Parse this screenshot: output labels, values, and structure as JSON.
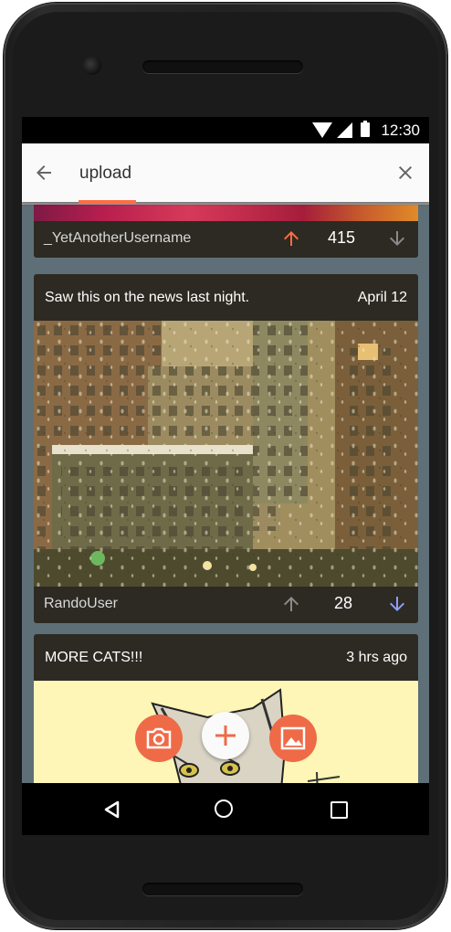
{
  "status_bar": {
    "time": "12:30"
  },
  "search": {
    "query": "upload"
  },
  "posts": [
    {
      "username": "_YetAnotherUsername",
      "score": "415",
      "vote": "up"
    },
    {
      "caption": "Saw this on the news last night.",
      "time": "April 12",
      "username": "RandoUser",
      "score": "28",
      "vote": "down"
    },
    {
      "caption": "MORE CATS!!!",
      "time": "3 hrs ago"
    }
  ],
  "fab_menu": {
    "items": [
      "camera-icon",
      "add-icon",
      "gallery-icon"
    ]
  },
  "colors": {
    "accent": "#ff6e40",
    "upvote": "#ff6e40",
    "downvote": "#8c9eff",
    "card_bar": "#2c2a22",
    "feed_bg": "#5f6f78"
  }
}
